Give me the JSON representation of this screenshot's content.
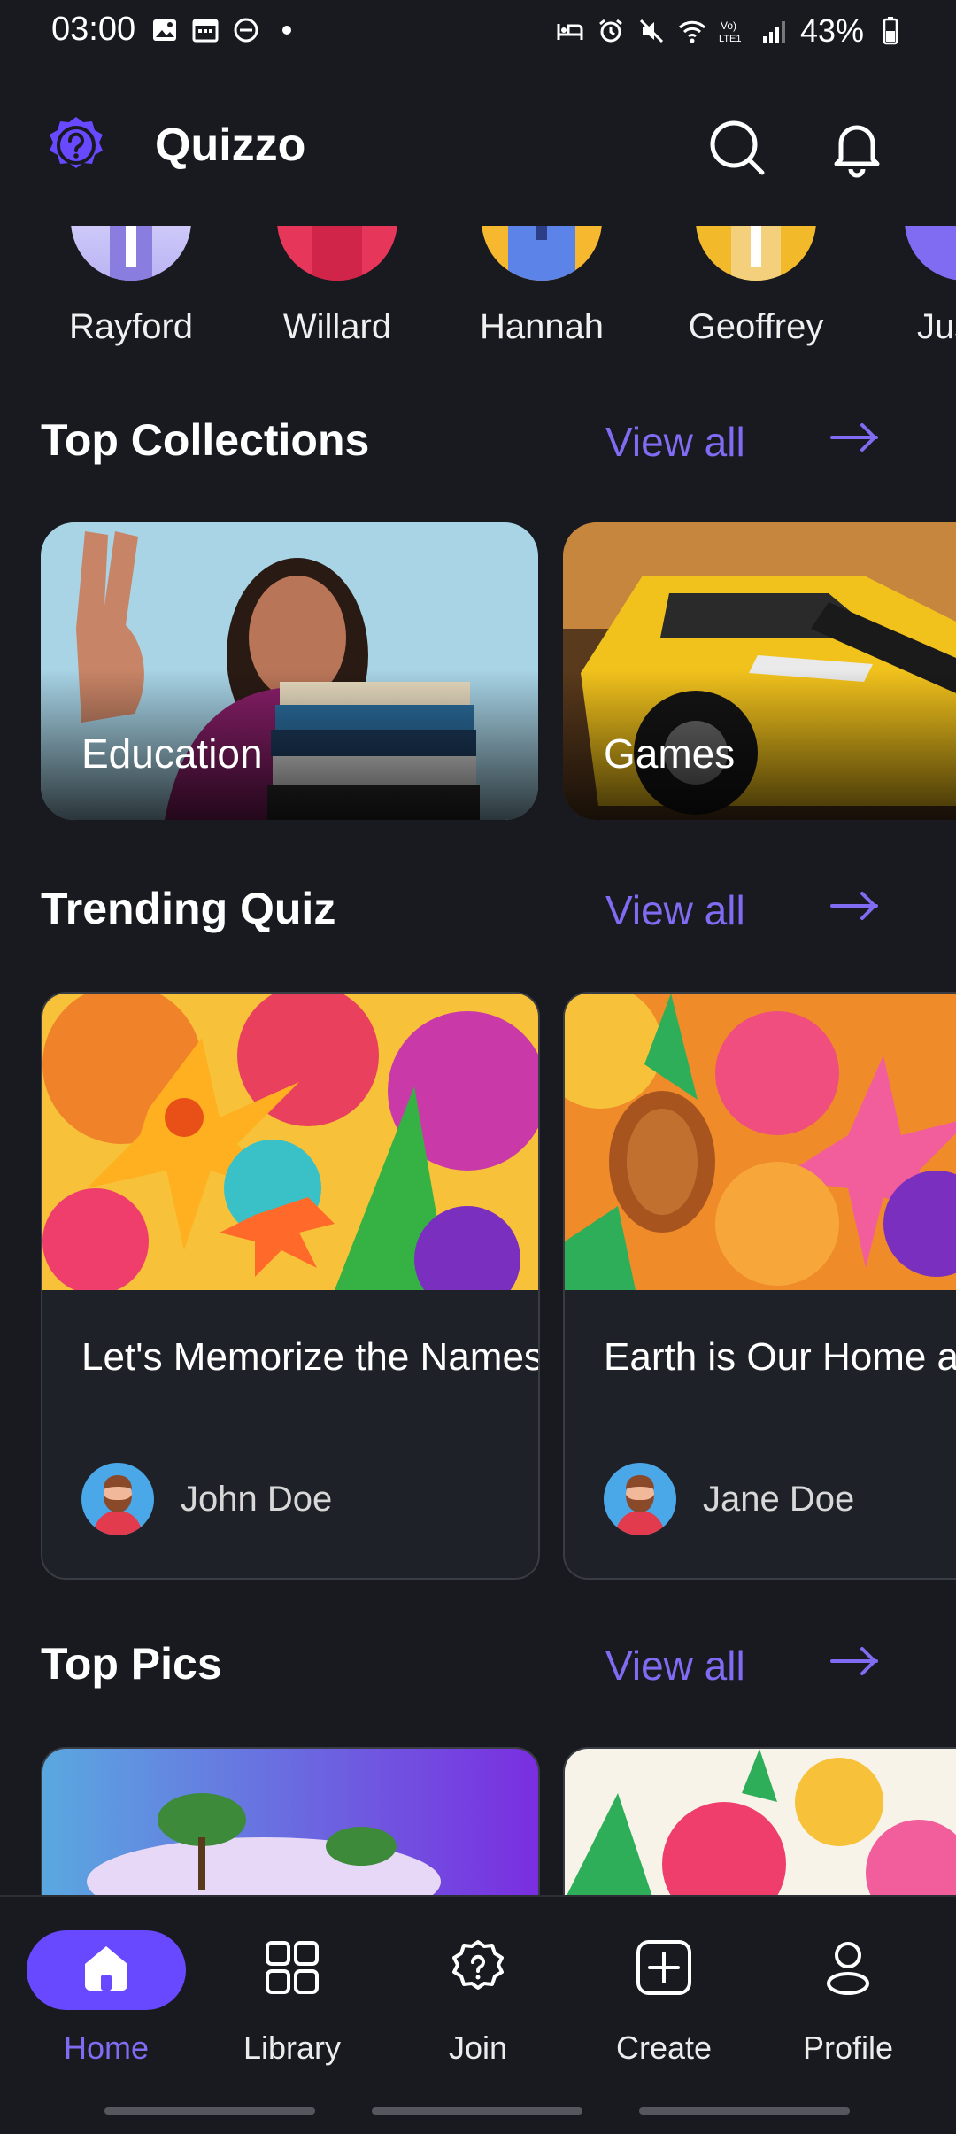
{
  "status_bar": {
    "time": "03:00",
    "battery": "43%",
    "left_icons": [
      "photo-icon",
      "calendar-icon",
      "dnd-icon",
      "dot-icon"
    ],
    "right_icons": [
      "bed-icon",
      "alarm-icon",
      "mute-icon",
      "wifi-icon",
      "volte-icon",
      "signal-icon",
      "battery-icon"
    ],
    "volte_label": "Vo)\nLTE1"
  },
  "header": {
    "title": "Quizzo",
    "icons": [
      "logo-icon",
      "search-icon",
      "bell-icon"
    ]
  },
  "users": [
    "Rayford",
    "Willard",
    "Hannah",
    "Geoffrey",
    "Jus"
  ],
  "sections": {
    "top_collections": {
      "title": "Top Collections",
      "view_all": "View all"
    },
    "trending_quiz": {
      "title": "Trending Quiz",
      "view_all": "View all"
    },
    "top_pics": {
      "title": "Top Pics",
      "view_all": "View all"
    }
  },
  "collections": [
    {
      "label": "Education"
    },
    {
      "label": "Games"
    }
  ],
  "trending": [
    {
      "title": "Let's Memorize the Names o...",
      "author": "John Doe"
    },
    {
      "title": "Earth is Our Home and Will...",
      "author": "Jane Doe"
    }
  ],
  "nav": [
    {
      "label": "Home",
      "icon": "home-icon",
      "active": true
    },
    {
      "label": "Library",
      "icon": "grid-icon",
      "active": false
    },
    {
      "label": "Join",
      "icon": "join-icon",
      "active": false
    },
    {
      "label": "Create",
      "icon": "plus-square-icon",
      "active": false
    },
    {
      "label": "Profile",
      "icon": "user-icon",
      "active": false
    }
  ],
  "colors": {
    "background": "#181a20",
    "accent": "#6949ff",
    "link": "#7f6cf2"
  }
}
